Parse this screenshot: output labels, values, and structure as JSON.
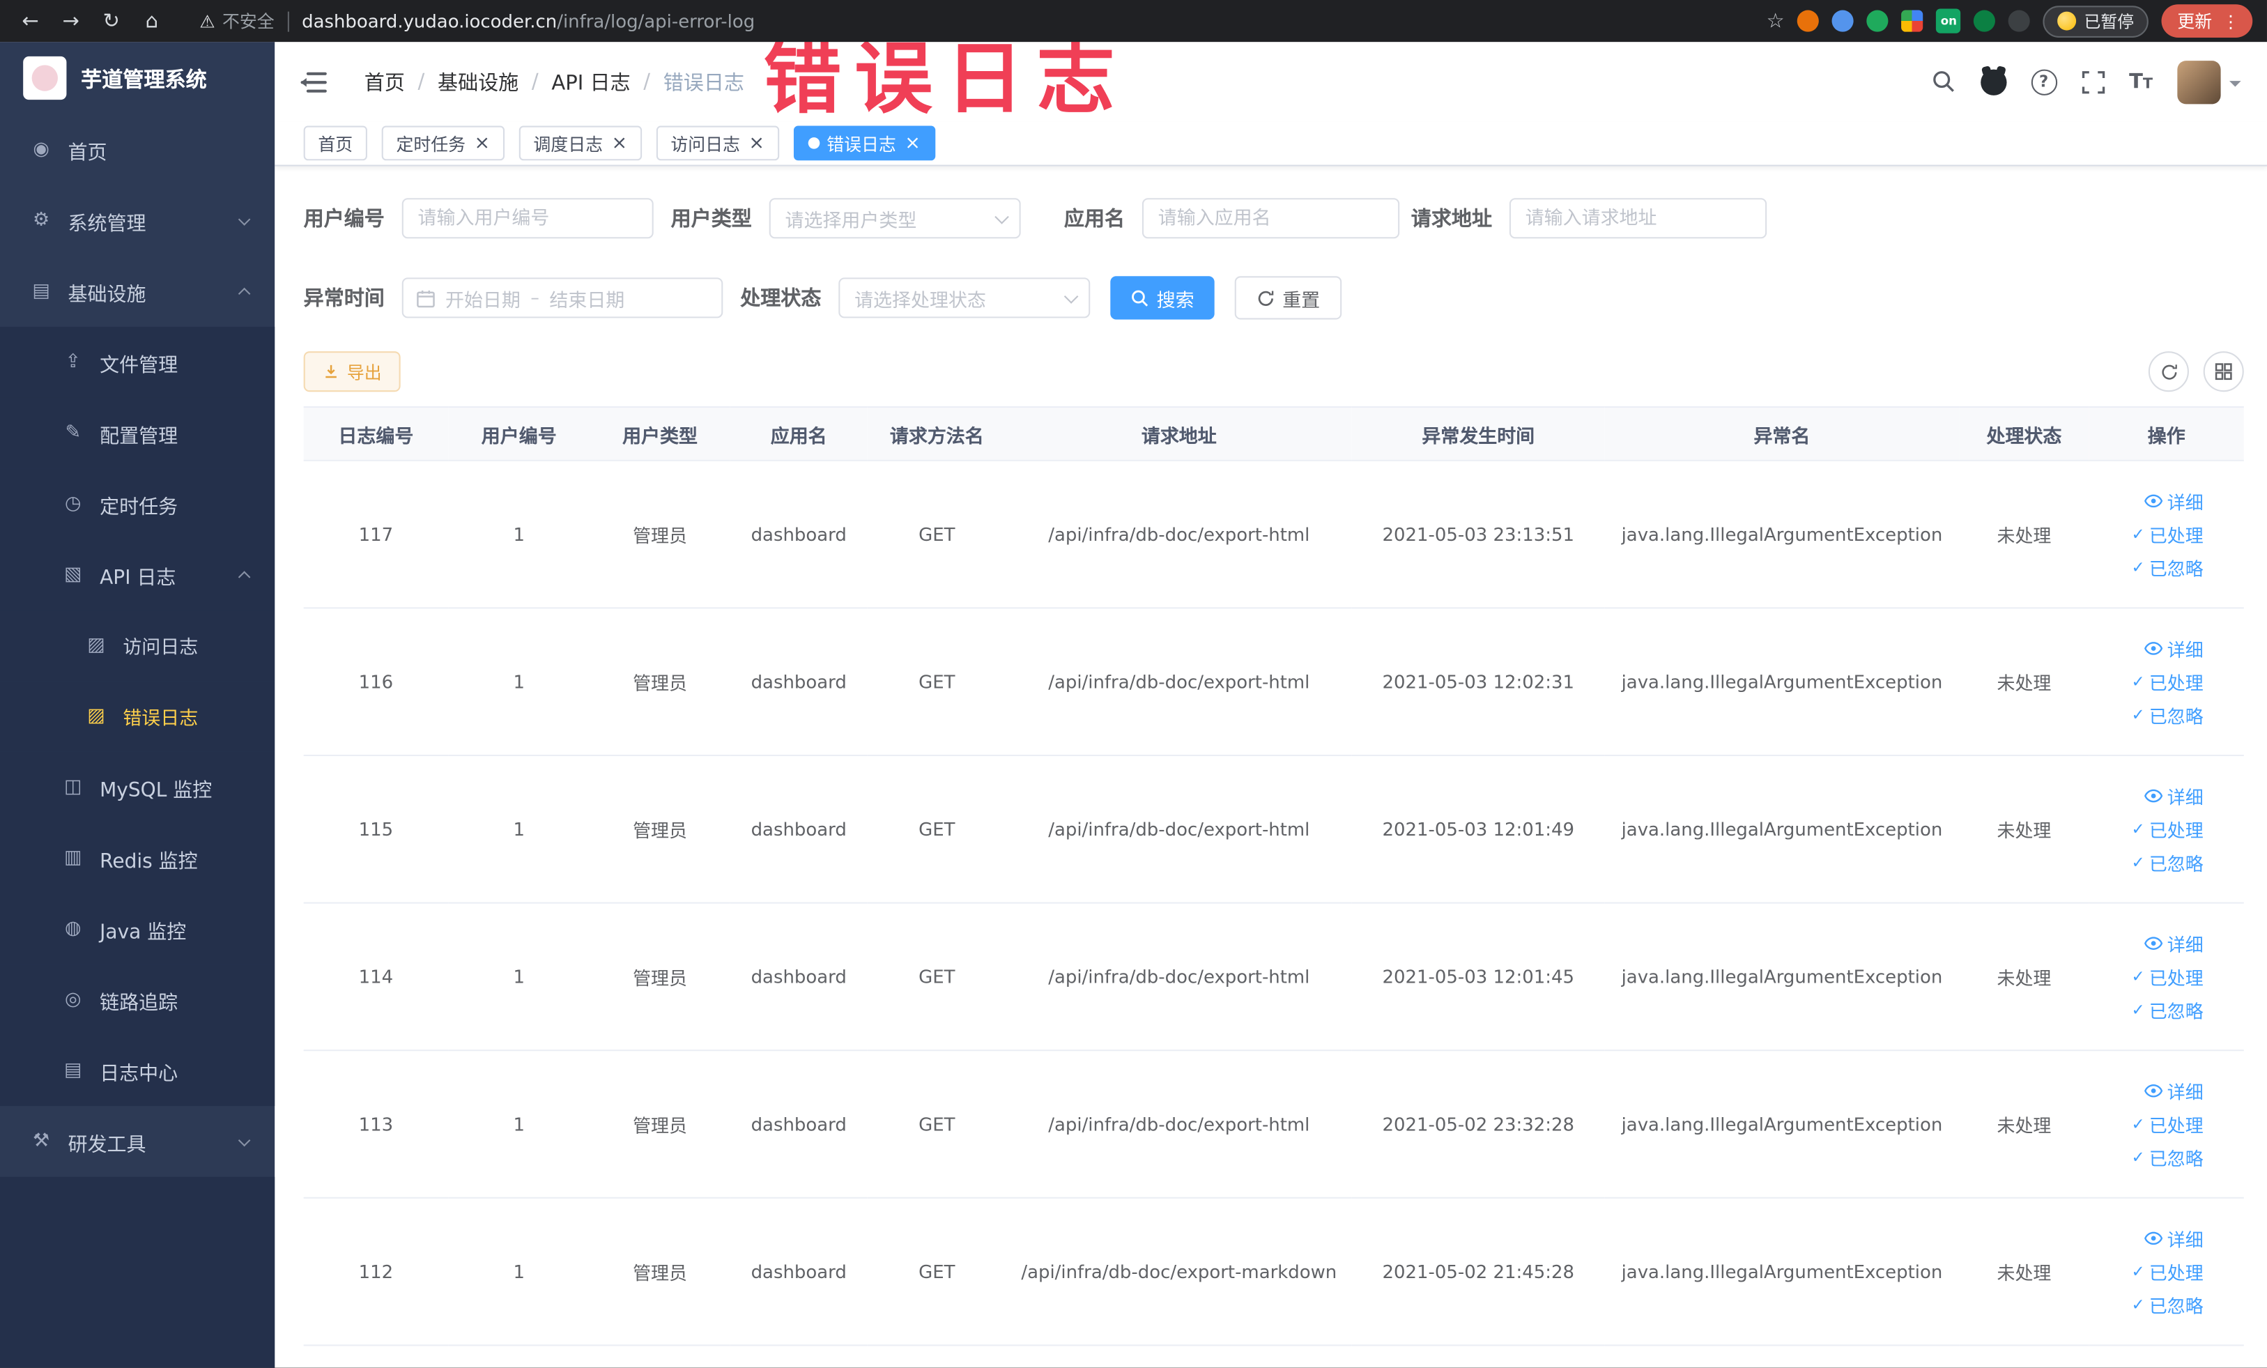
{
  "browser": {
    "nav": [
      {
        "name": "back-icon",
        "glyph": "←",
        "dim": false
      },
      {
        "name": "forward-icon",
        "glyph": "→",
        "dim": false
      },
      {
        "name": "reload-icon",
        "glyph": "↻",
        "dim": false
      },
      {
        "name": "home-icon",
        "glyph": "⌂",
        "dim": false
      }
    ],
    "warning_glyph": "⚠",
    "security_label": "不安全",
    "url_domain": "dashboard.yudao.iocoder.cn",
    "url_path": "/infra/log/api-error-log",
    "star_glyph": "☆",
    "extensions": [
      {
        "name": "extension-orange-icon",
        "color": "#e8710a",
        "shape": "circle"
      },
      {
        "name": "extension-blue-icon",
        "color": "#5494ec",
        "shape": "circle"
      },
      {
        "name": "extension-green-icon",
        "color": "#1faa5c",
        "shape": "circle"
      },
      {
        "name": "extension-grid-icon",
        "color": "",
        "shape": "grid"
      },
      {
        "name": "extension-on-icon",
        "color": "#13a463",
        "shape": "pill",
        "text": "on"
      },
      {
        "name": "extension-leaf-icon",
        "color": "#0b8043",
        "shape": "circle"
      },
      {
        "name": "extension-dark-icon",
        "color": "#3c4043",
        "shape": "circle"
      }
    ],
    "paused_label": "已暂停",
    "update_label": "更新",
    "menu_dots": "⋮"
  },
  "watermark": "错误日志",
  "sidebar": {
    "title": "芋道管理系统",
    "items": [
      {
        "key": "home",
        "label": "首页",
        "icon": "home-icon",
        "glyph": "◉",
        "level": 0
      },
      {
        "key": "system",
        "label": "系统管理",
        "icon": "gear-icon",
        "glyph": "⚙",
        "level": 0,
        "chevron": "down"
      },
      {
        "key": "infra",
        "label": "基础设施",
        "icon": "infra-icon",
        "glyph": "▤",
        "level": 0,
        "chevron": "up"
      },
      {
        "key": "file",
        "label": "文件管理",
        "icon": "file-upload-icon",
        "glyph": "⇪",
        "level": 1
      },
      {
        "key": "config",
        "label": "配置管理",
        "icon": "config-edit-icon",
        "glyph": "✎",
        "level": 1
      },
      {
        "key": "job",
        "label": "定时任务",
        "icon": "timer-icon",
        "glyph": "◷",
        "level": 1
      },
      {
        "key": "api-log",
        "label": "API 日志",
        "icon": "api-log-icon",
        "glyph": "▧",
        "level": 1,
        "chevron": "up"
      },
      {
        "key": "access-log",
        "label": "访问日志",
        "icon": "access-log-icon",
        "glyph": "▨",
        "level": 2
      },
      {
        "key": "error-log",
        "label": "错误日志",
        "icon": "error-log-icon",
        "glyph": "▨",
        "level": 2,
        "active": true
      },
      {
        "key": "mysql",
        "label": "MySQL 监控",
        "icon": "mysql-monitor-icon",
        "glyph": "◫",
        "level": 1
      },
      {
        "key": "redis",
        "label": "Redis 监控",
        "icon": "redis-monitor-icon",
        "glyph": "▥",
        "level": 1
      },
      {
        "key": "java",
        "label": "Java 监控",
        "icon": "java-monitor-icon",
        "glyph": "◍",
        "level": 1
      },
      {
        "key": "tracer",
        "label": "链路追踪",
        "icon": "trace-icon",
        "glyph": "◎",
        "level": 1
      },
      {
        "key": "log-center",
        "label": "日志中心",
        "icon": "log-center-icon",
        "glyph": "▤",
        "level": 1
      },
      {
        "key": "dev-tools",
        "label": "研发工具",
        "icon": "devtools-icon",
        "glyph": "⚒",
        "level": 0,
        "chevron": "down"
      }
    ]
  },
  "breadcrumb": [
    "首页",
    "基础设施",
    "API 日志",
    "错误日志"
  ],
  "tabs": [
    {
      "label": "首页",
      "closable": false,
      "active": false
    },
    {
      "label": "定时任务",
      "closable": true,
      "active": false
    },
    {
      "label": "调度日志",
      "closable": true,
      "active": false
    },
    {
      "label": "访问日志",
      "closable": true,
      "active": false
    },
    {
      "label": "错误日志",
      "closable": true,
      "active": true
    }
  ],
  "filters": {
    "user_id": {
      "label": "用户编号",
      "placeholder": "请输入用户编号"
    },
    "user_type": {
      "label": "用户类型",
      "placeholder": "请选择用户类型"
    },
    "app_name": {
      "label": "应用名",
      "placeholder": "请输入应用名"
    },
    "request_url": {
      "label": "请求地址",
      "placeholder": "请输入请求地址"
    },
    "exception_time": {
      "label": "异常时间",
      "start_placeholder": "开始日期",
      "separator": "–",
      "end_placeholder": "结束日期"
    },
    "process_status": {
      "label": "处理状态",
      "placeholder": "请选择处理状态"
    },
    "search_label": "搜索",
    "reset_label": "重置"
  },
  "toolbar": {
    "export_label": "导出"
  },
  "table": {
    "columns": [
      {
        "key": "log-id",
        "label": "日志编号"
      },
      {
        "key": "user-id",
        "label": "用户编号"
      },
      {
        "key": "user-type",
        "label": "用户类型"
      },
      {
        "key": "app-name",
        "label": "应用名"
      },
      {
        "key": "method",
        "label": "请求方法名"
      },
      {
        "key": "url",
        "label": "请求地址"
      },
      {
        "key": "time",
        "label": "异常发生时间"
      },
      {
        "key": "exception",
        "label": "异常名"
      },
      {
        "key": "status",
        "label": "处理状态"
      },
      {
        "key": "actions",
        "label": "操作"
      }
    ],
    "rows": [
      {
        "id": "117",
        "user_id": "1",
        "user_type": "管理员",
        "app": "dashboard",
        "method": "GET",
        "url": "/api/infra/db-doc/export-html",
        "time": "2021-05-03 23:13:51",
        "exception": "java.lang.IllegalArgumentException",
        "status": "未处理"
      },
      {
        "id": "116",
        "user_id": "1",
        "user_type": "管理员",
        "app": "dashboard",
        "method": "GET",
        "url": "/api/infra/db-doc/export-html",
        "time": "2021-05-03 12:02:31",
        "exception": "java.lang.IllegalArgumentException",
        "status": "未处理"
      },
      {
        "id": "115",
        "user_id": "1",
        "user_type": "管理员",
        "app": "dashboard",
        "method": "GET",
        "url": "/api/infra/db-doc/export-html",
        "time": "2021-05-03 12:01:49",
        "exception": "java.lang.IllegalArgumentException",
        "status": "未处理"
      },
      {
        "id": "114",
        "user_id": "1",
        "user_type": "管理员",
        "app": "dashboard",
        "method": "GET",
        "url": "/api/infra/db-doc/export-html",
        "time": "2021-05-03 12:01:45",
        "exception": "java.lang.IllegalArgumentException",
        "status": "未处理"
      },
      {
        "id": "113",
        "user_id": "1",
        "user_type": "管理员",
        "app": "dashboard",
        "method": "GET",
        "url": "/api/infra/db-doc/export-html",
        "time": "2021-05-02 23:32:28",
        "exception": "java.lang.IllegalArgumentException",
        "status": "未处理"
      },
      {
        "id": "112",
        "user_id": "1",
        "user_type": "管理员",
        "app": "dashboard",
        "method": "GET",
        "url": "/api/infra/db-doc/export-markdown",
        "time": "2021-05-02 21:45:28",
        "exception": "java.lang.IllegalArgumentException",
        "status": "未处理"
      }
    ],
    "actions": [
      {
        "key": "detail",
        "label": "详细",
        "icon": "eye-icon"
      },
      {
        "key": "processed",
        "label": "已处理",
        "icon": "check-icon"
      },
      {
        "key": "ignored",
        "label": "已忽略",
        "icon": "check-icon"
      }
    ]
  },
  "colors": {
    "primary": "#409eff",
    "warning": "#e6a23c",
    "watermark": "#f03f56",
    "active_menu": "#ffd04b"
  }
}
